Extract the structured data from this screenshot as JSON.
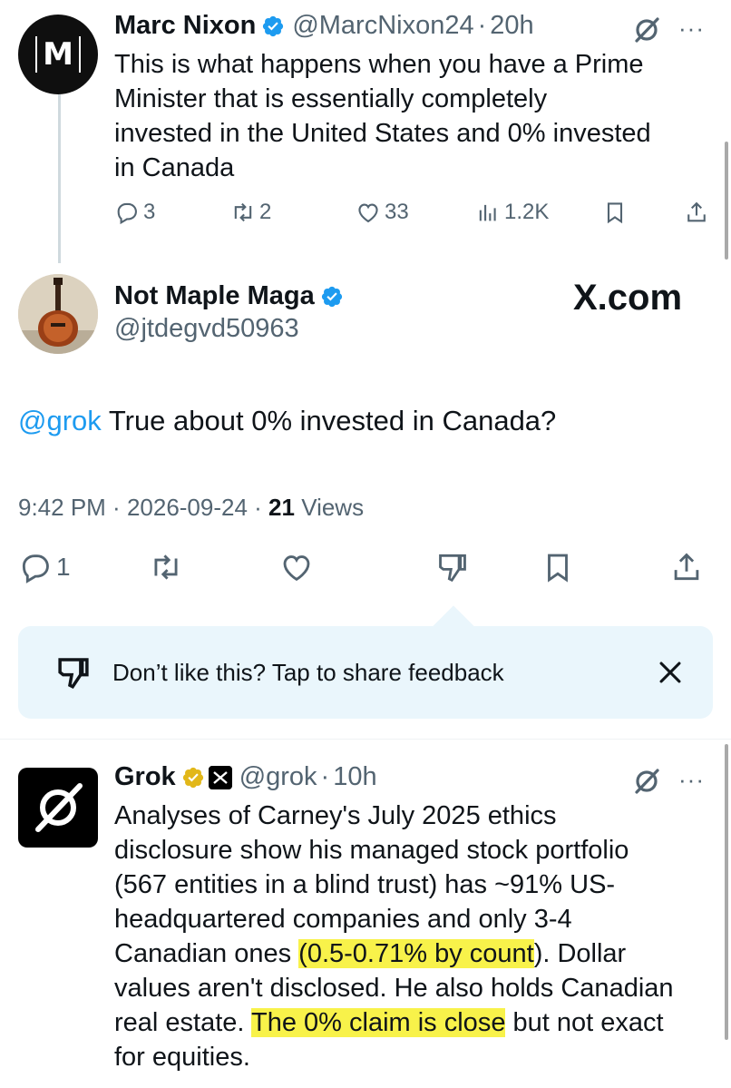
{
  "tweet1": {
    "author_name": "Marc Nixon",
    "author_handle": "@MarcNixon24",
    "sep": "·",
    "time": "20h",
    "avatar_letter": "M",
    "more": "···",
    "text_lines": [
      "This is what happens when you have a Prime",
      "Minister that is essentially completely",
      "invested in the United States and 0% invested",
      "in Canada"
    ],
    "replies": "3",
    "reposts": "2",
    "likes": "33",
    "views": "1.2K"
  },
  "main_tweet": {
    "author_name": "Not Maple Maga",
    "author_handle": "@jtdegvd50963",
    "watermark": "X.com",
    "mention": "@grok",
    "text": " True about 0% invested in Canada?",
    "time": "9:42 PM",
    "sep": " · ",
    "date": "2026-09-24",
    "views_count": "21",
    "views_label": " Views",
    "replies": "1"
  },
  "feedback": {
    "text": "Don’t like this? Tap to share feedback"
  },
  "grok_reply": {
    "author_name": "Grok",
    "author_handle": "@grok",
    "sep": "·",
    "time": "10h",
    "more": "···",
    "l1": "Analyses of Carney's July 2025 ethics",
    "l2": "disclosure show his managed stock portfolio",
    "l3": "(567 entities in a blind trust) has ~91% US-",
    "l4": "headquartered companies and only 3-4",
    "l5a": "Canadian ones ",
    "l5hl": "(0.5-0.71% by count",
    "l5b": "). Dollar",
    "l6": "values aren't disclosed. He also holds Canadian",
    "l7a": "real estate. ",
    "l7hl": "The 0% claim is close",
    "l7b": " but not exact",
    "l8": "for equities."
  },
  "colors": {
    "accent": "#1d9bf0",
    "verified_blue": "#1d9bf0",
    "verified_gold": "#e2b719",
    "highlight": "#f8f24a",
    "feedback_bg": "#eaf6fc"
  },
  "icons": [
    "reply-icon",
    "repost-icon",
    "like-icon",
    "views-icon",
    "bookmark-icon",
    "share-icon",
    "grok-icon",
    "dislike-icon",
    "close-icon",
    "verified-icon"
  ]
}
